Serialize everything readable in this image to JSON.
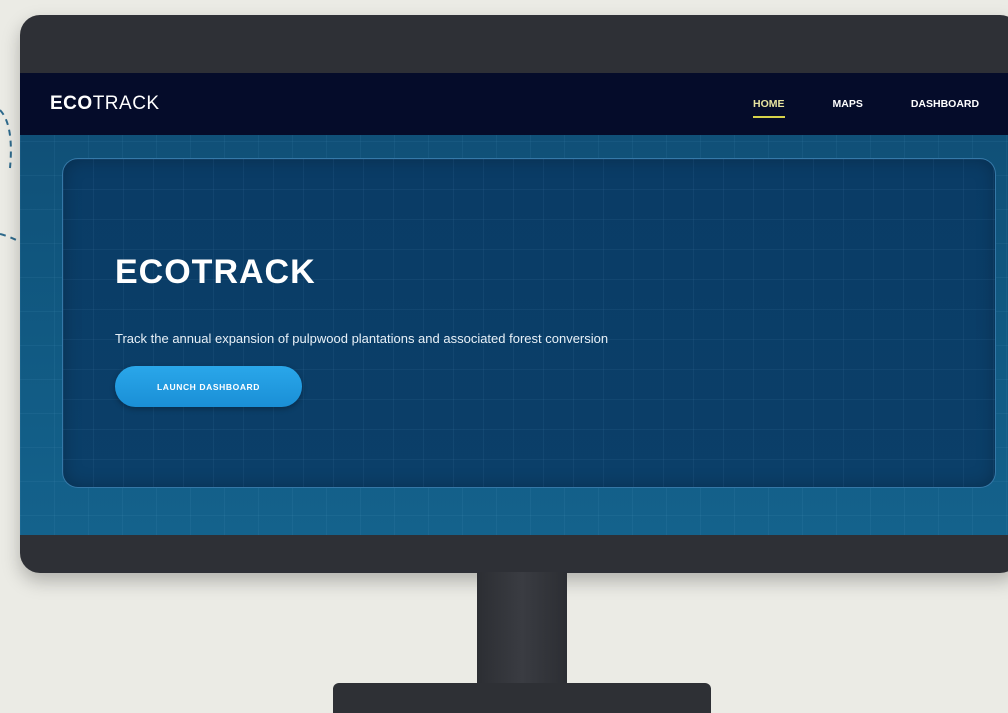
{
  "brand": {
    "logo_bold": "ECO",
    "logo_rest": "TRACK"
  },
  "nav": {
    "items": [
      {
        "label": "HOME",
        "active": true
      },
      {
        "label": "MAPS",
        "active": false
      },
      {
        "label": "DASHBOARD",
        "active": false
      }
    ]
  },
  "hero": {
    "title": "ECOTRACK",
    "subtitle": "Track the annual expansion of pulpwood plantations and associated forest conversion",
    "button_label": "LAUNCH DASHBOARD"
  },
  "colors": {
    "navbar": "#050c2a",
    "hero_bg": "#0b3f69",
    "accent_button": "#1a8fd6",
    "nav_active_underline": "#d6d24a"
  }
}
